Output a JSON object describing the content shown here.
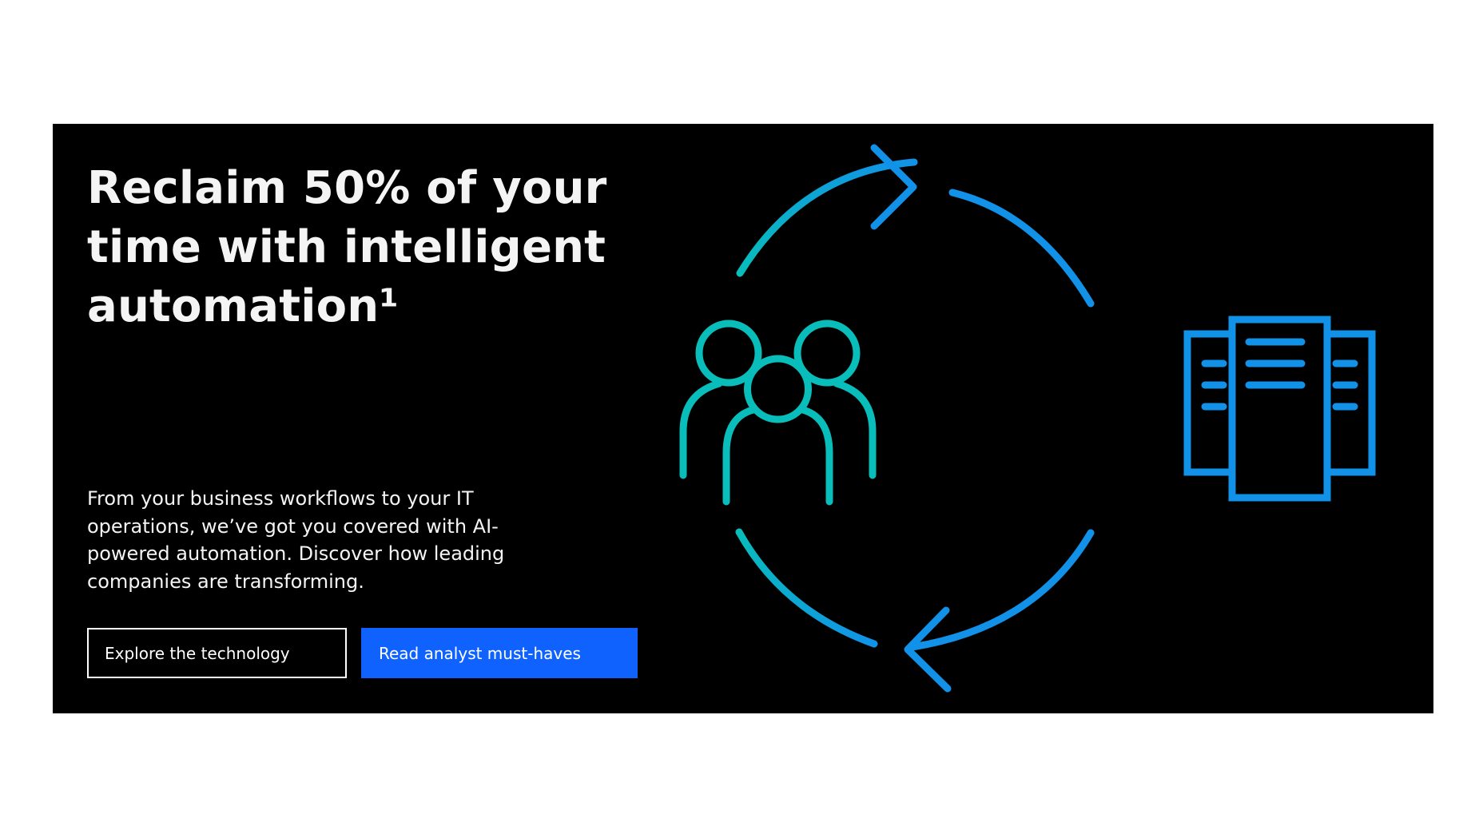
{
  "hero": {
    "headline": "Reclaim 50% of your time with intelligent automation¹",
    "description": "From your business workflows to your IT operations, we’ve got you covered with AI-powered automation. Discover how leading companies are transforming.",
    "buttons": {
      "secondary_label": "Explore the technology",
      "primary_label": "Read analyst must-haves"
    }
  },
  "illustration": {
    "icons": [
      "cycle-arrows-icon",
      "people-group-icon",
      "documents-icon"
    ],
    "colors": {
      "cyan": "#08bdba",
      "blue": "#0f62fe",
      "sky": "#1192e8"
    }
  },
  "colors": {
    "background": "#000000",
    "text": "#f4f4f4",
    "primary_button": "#0f62fe"
  }
}
